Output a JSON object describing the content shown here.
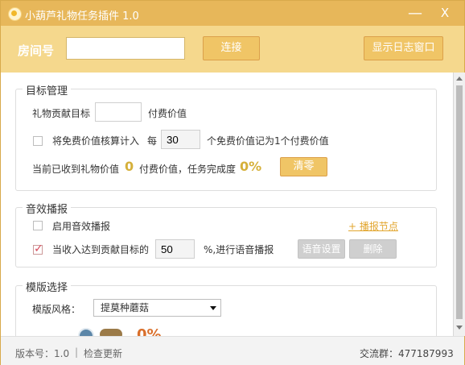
{
  "window": {
    "title": "小葫芦礼物任务插件 1.0",
    "minimize": "—",
    "close": "X"
  },
  "top": {
    "room_label": "房间号",
    "room_value": "",
    "connect": "连接",
    "show_log": "显示日志窗口"
  },
  "target": {
    "legend": "目标管理",
    "gift_label": "礼物贡献目标",
    "paid_value_unit": "付费价值",
    "free_checkbox_label": "将免费价值核算计入",
    "every": "每",
    "free_input": "30",
    "free_suffix": "个免费价值记为1个付费价值",
    "received_prefix": "当前已收到礼物价值",
    "received_value": "0",
    "received_suffix": "付费价值，任务完成度",
    "completion": "0%",
    "clear": "清零"
  },
  "sound": {
    "legend": "音效播报",
    "enable_label": "启用音效播报",
    "add_node": "+ 播报节点",
    "reach_label": "当收入达到贡献目标的",
    "reach_value": "50",
    "reach_suffix": "%,进行语音播报",
    "voice_settings": "语音设置",
    "delete": "删除"
  },
  "template": {
    "legend": "模版选择",
    "style_label": "模版风格：",
    "style_value": "提莫种蘑菇",
    "preview_percent": "0%"
  },
  "status": {
    "version": "版本号：1.0",
    "separator": "|",
    "check_update": "检查更新",
    "group": "交流群：477187993"
  },
  "colors": {
    "title": "#e7b75a",
    "top": "#f5d88d",
    "accent": "#f0c566",
    "gold": "#d5b03a"
  }
}
